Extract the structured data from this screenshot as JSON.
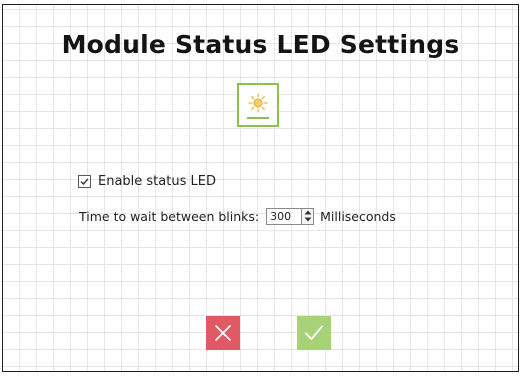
{
  "dialog": {
    "title": "Module Status LED Settings",
    "icon": "led-brightness-icon",
    "accent_color": "#8cc152"
  },
  "enable_led": {
    "label": "Enable status LED",
    "checked": true
  },
  "blink_interval": {
    "label": "Time to wait between blinks:",
    "value": "300",
    "units": "Milliseconds"
  },
  "actions": {
    "cancel_icon": "close-icon",
    "cancel_color": "#e15a63",
    "ok_icon": "checkmark-icon",
    "ok_color": "#a8d277"
  }
}
